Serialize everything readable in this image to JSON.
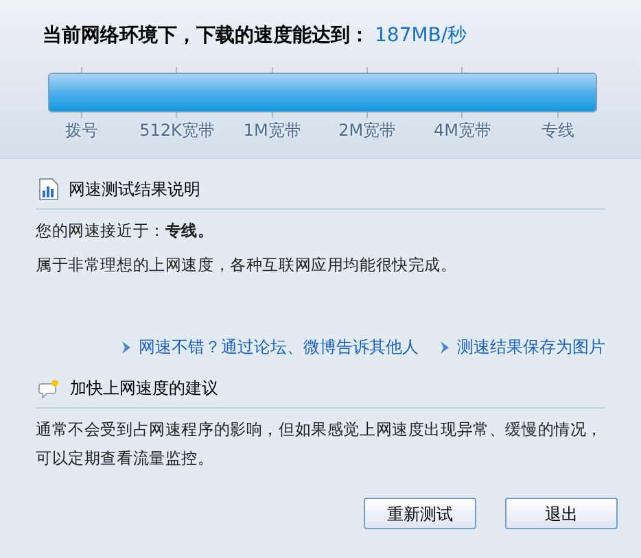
{
  "headline": {
    "text": "当前网络环境下，下载的速度能达到：",
    "speed": "187MB/秒"
  },
  "meter": {
    "level": 1,
    "labels": [
      "拨号",
      "512K宽带",
      "1M宽带",
      "2M宽带",
      "4M宽带",
      "专线"
    ]
  },
  "sections": [
    {
      "kind": "chart",
      "title": "网速测试结果说明",
      "lines": [
        "您的网速接近于：**专线。**",
        "属于非常理想的上网速度，各种互联网应用均能很快完成。"
      ],
      "links": [
        "网速不错？通过论坛、微博告诉其他人",
        "测速结果保存为图片"
      ]
    },
    {
      "kind": "tip",
      "title": "加快上网速度的建议",
      "lines": [
        "通常不会受到占网速程序的影响，但如果感觉上网速度出现异常、缓慢的情况，可以定期查看流量监控。"
      ]
    }
  ],
  "buttons": [
    "重新测试",
    "退出"
  ]
}
